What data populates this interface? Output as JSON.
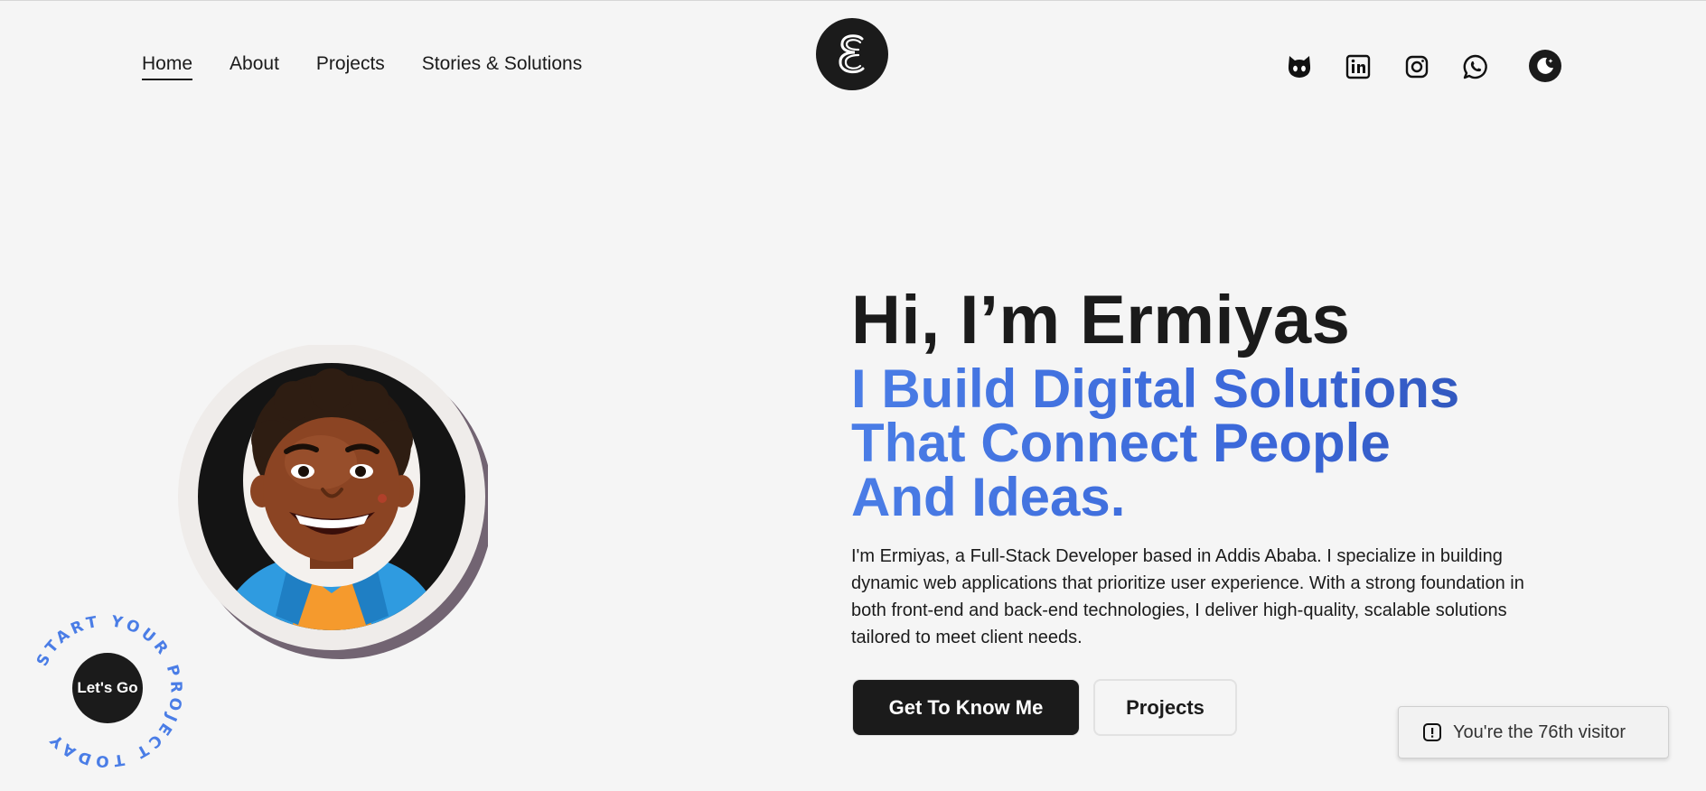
{
  "nav": {
    "links": [
      "Home",
      "About",
      "Projects",
      "Stories & Solutions"
    ],
    "active": "Home"
  },
  "logo": {
    "letter": "E"
  },
  "socials": [
    "github-icon",
    "linkedin-icon",
    "instagram-icon",
    "whatsapp-icon"
  ],
  "theme_toggle": {
    "icon": "moon-icon"
  },
  "hero": {
    "title": "Hi, I’m Ermiyas",
    "subtitle_lines": [
      "I Build Digital Solutions",
      "That Connect People",
      "And Ideas."
    ],
    "description": "I'm Ermiyas, a Full-Stack Developer based in Addis Ababa. I specialize in building dynamic web applications that prioritize user experience. With a strong foundation in both front-end and back-end technologies, I deliver high-quality, scalable solutions tailored to meet client needs.",
    "primary_button": "Get To Know Me",
    "secondary_button": "Projects"
  },
  "badge": {
    "circular_text": "START YOUR PROJECT TODAY ",
    "button": "Let's Go"
  },
  "visitor": {
    "text": "You're the 76th visitor"
  },
  "colors": {
    "accent": "#4a7de6",
    "dark": "#1b1b1b",
    "background": "#f5f5f5"
  }
}
